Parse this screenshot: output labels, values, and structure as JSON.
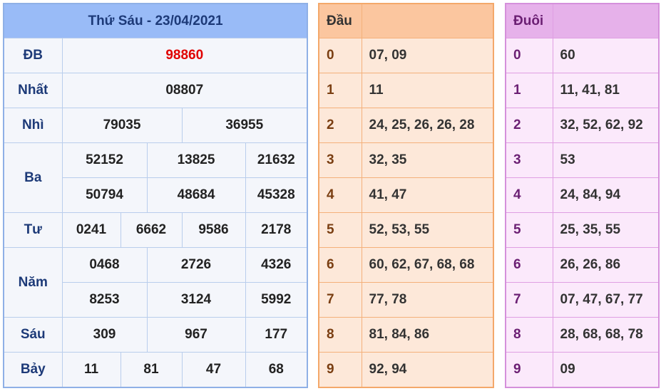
{
  "results": {
    "title": "Thứ Sáu - 23/04/2021",
    "rows": [
      {
        "label": "ĐB",
        "values": [
          "98860"
        ]
      },
      {
        "label": "Nhất",
        "values": [
          "08807"
        ]
      },
      {
        "label": "Nhì",
        "values": [
          "79035",
          "36955"
        ]
      },
      {
        "label": "Ba",
        "values": [
          "52152",
          "13825",
          "21632",
          "50794",
          "48684",
          "45328"
        ]
      },
      {
        "label": "Tư",
        "values": [
          "0241",
          "6662",
          "9586",
          "2178"
        ]
      },
      {
        "label": "Năm",
        "values": [
          "0468",
          "2726",
          "4326",
          "8253",
          "3124",
          "5992"
        ]
      },
      {
        "label": "Sáu",
        "values": [
          "309",
          "967",
          "177"
        ]
      },
      {
        "label": "Bảy",
        "values": [
          "11",
          "81",
          "47",
          "68"
        ]
      }
    ],
    "special_color": "#e00000"
  },
  "dau": {
    "header": "Đầu",
    "rows": [
      {
        "digit": "0",
        "values": "07, 09"
      },
      {
        "digit": "1",
        "values": "11"
      },
      {
        "digit": "2",
        "values": "24, 25, 26, 26, 28"
      },
      {
        "digit": "3",
        "values": "32, 35"
      },
      {
        "digit": "4",
        "values": "41, 47"
      },
      {
        "digit": "5",
        "values": "52, 53, 55"
      },
      {
        "digit": "6",
        "values": "60, 62, 67, 68, 68"
      },
      {
        "digit": "7",
        "values": "77, 78"
      },
      {
        "digit": "8",
        "values": "81, 84, 86"
      },
      {
        "digit": "9",
        "values": "92, 94"
      }
    ]
  },
  "duoi": {
    "header": "Đuôi",
    "rows": [
      {
        "digit": "0",
        "values": "60"
      },
      {
        "digit": "1",
        "values": "11, 41, 81"
      },
      {
        "digit": "2",
        "values": "32, 52, 62, 92"
      },
      {
        "digit": "3",
        "values": "53"
      },
      {
        "digit": "4",
        "values": "24, 84, 94"
      },
      {
        "digit": "5",
        "values": "25, 35, 55"
      },
      {
        "digit": "6",
        "values": "26, 26, 86"
      },
      {
        "digit": "7",
        "values": "07, 47, 67, 77"
      },
      {
        "digit": "8",
        "values": "28, 68, 68, 78"
      },
      {
        "digit": "9",
        "values": "09"
      }
    ]
  }
}
